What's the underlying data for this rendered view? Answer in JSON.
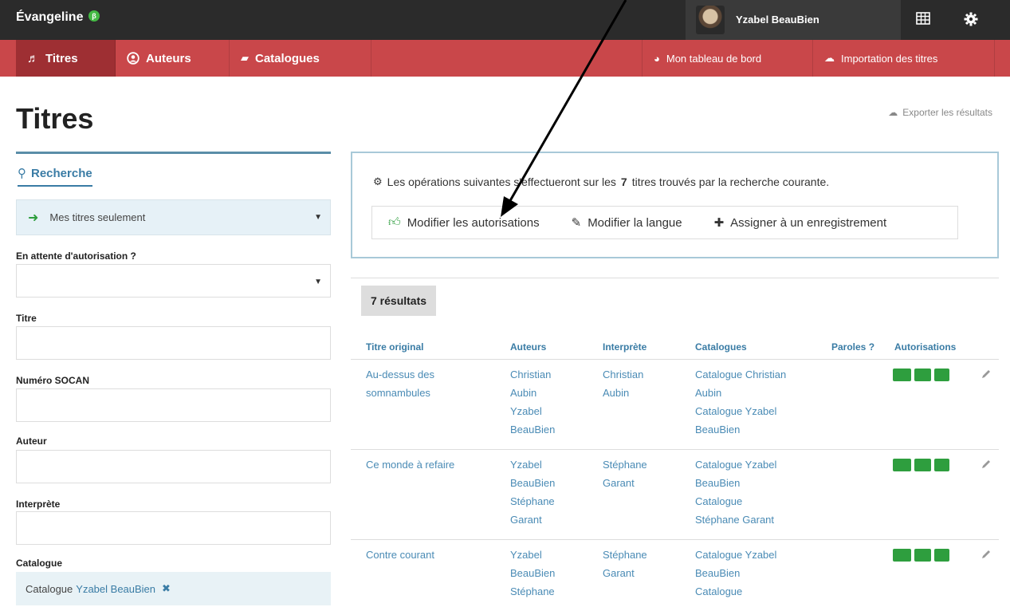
{
  "header": {
    "brand": "Évangeline",
    "beta_badge": "β",
    "user_name": "Yzabel BeauBien"
  },
  "nav": {
    "titres": "Titres",
    "auteurs": "Auteurs",
    "catalogues": "Catalogues",
    "dashboard": "Mon tableau de bord",
    "import": "Importation des titres"
  },
  "page": {
    "title": "Titres",
    "export": "Exporter les résultats"
  },
  "search": {
    "tab_label": "Recherche",
    "scope_value": "Mes titres seulement",
    "pending_label": "En attente d'autorisation ?",
    "title_label": "Titre",
    "socan_label": "Numéro SOCAN",
    "author_label": "Auteur",
    "performer_label": "Interprète",
    "catalogue_label": "Catalogue",
    "catalogue_chip_prefix": "Catalogue",
    "catalogue_chip_value": "Yzabel BeauBien"
  },
  "bulk": {
    "text_before": "Les opérations suivantes s'effectueront sur les",
    "count": "7",
    "text_after": "titres trouvés par la recherche courante.",
    "edit_permissions": "Modifier les autorisations",
    "edit_language": "Modifier la langue",
    "assign_recording": "Assigner à un enregistrement"
  },
  "results": {
    "count_label": "7 résultats",
    "columns": [
      "Titre original",
      "Auteurs",
      "Interprète",
      "Catalogues",
      "Paroles ?",
      "Autorisations"
    ],
    "rows": [
      {
        "title": [
          "Au-dessus des",
          "somnambules"
        ],
        "authors": [
          "Christian",
          "Aubin",
          "Yzabel",
          "BeauBien"
        ],
        "performer": [
          "Christian",
          "Aubin"
        ],
        "catalogues": [
          "Catalogue Christian",
          "Aubin",
          "Catalogue Yzabel",
          "BeauBien"
        ]
      },
      {
        "title": [
          "Ce monde à refaire"
        ],
        "authors": [
          "Yzabel",
          "BeauBien",
          "Stéphane",
          "Garant"
        ],
        "performer": [
          "Stéphane",
          "Garant"
        ],
        "catalogues": [
          "Catalogue Yzabel",
          "BeauBien",
          "Catalogue",
          "Stéphane Garant"
        ]
      },
      {
        "title": [
          "Contre courant"
        ],
        "authors": [
          "Yzabel",
          "BeauBien",
          "Stéphane"
        ],
        "performer": [
          "Stéphane",
          "Garant"
        ],
        "catalogues": [
          "Catalogue Yzabel",
          "BeauBien",
          "Catalogue"
        ]
      }
    ]
  },
  "colors": {
    "topbar": "#2b2b2b",
    "navbar": "#c9474a",
    "nav_active": "#9e2f33",
    "link": "#3a7ca5",
    "auth_green": "#2e9e3e"
  }
}
